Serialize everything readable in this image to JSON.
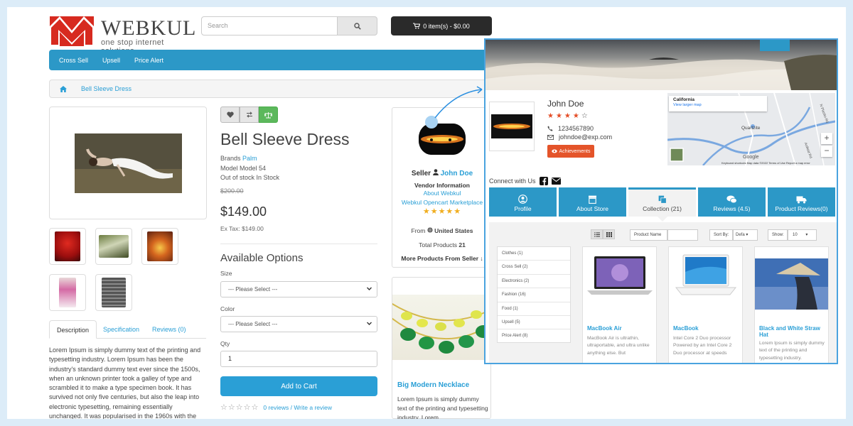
{
  "header": {
    "logo_name": "WEBKUL",
    "logo_tagline": "one stop internet solutions",
    "search_placeholder": "Search",
    "cart_label": "0 item(s) - $0.00"
  },
  "nav": {
    "items": [
      "Cross Sell",
      "Upsell",
      "Price Alert"
    ]
  },
  "breadcrumb": {
    "current": "Bell Sleeve Dress"
  },
  "product": {
    "title": "Bell Sleeve Dress",
    "brand_label": "Brands",
    "brand": "Palm",
    "model": "Model Model 54",
    "stock": "Out of stock In Stock",
    "old_price": "$200.00",
    "price": "$149.00",
    "ex_tax": "Ex Tax: $149.00",
    "options_title": "Available Options",
    "size_label": "Size",
    "size_value": "--- Please Select ---",
    "color_label": "Color",
    "color_value": "--- Please Select ---",
    "qty_label": "Qty",
    "qty_value": "1",
    "add_to_cart": "Add to Cart",
    "reviews_link": "0 reviews",
    "write_review": "Write a review",
    "tabs": [
      "Description",
      "Specification",
      "Reviews (0)"
    ],
    "description": "Lorem Ipsum is simply dummy text of the printing and typesetting industry. Lorem Ipsum has been the industry's standard dummy text ever since the 1500s, when an unknown printer took a galley of type and scrambled it to make a type specimen book. It has survived not only five centuries, but also the leap into electronic typesetting, remaining essentially unchanged. It was popularised in the 1960s with the release of Letraset sheets containing Lorem"
  },
  "seller": {
    "label": "Seller",
    "name": "John Doe",
    "vendor_info": "Vendor Information",
    "about": "About Webkul",
    "store": "Webkul Opencart Marketplace",
    "rating": 5,
    "from_label": "From",
    "country": "United States",
    "total_label": "Total Products",
    "total": "21",
    "more": "More Products From Seller"
  },
  "related": {
    "title": "Big Modern Necklace",
    "desc": "Lorem Ipsum is simply dummy text of the printing and typesetting industry. Lorem"
  },
  "profile": {
    "name": "John Doe",
    "rating": 4,
    "phone": "1234567890",
    "email": "johndoe@exp.com",
    "achievements": "Achievements",
    "map_title": "California",
    "map_link": "View larger map",
    "map_town": "Quartzite",
    "map_road_a": "N Plasito Rd",
    "map_road_b": "Anfield Rd",
    "map_brand": "Google",
    "map_footer": "Keyboard shortcuts   Map data ©2022   Terms of Use   Report a map error",
    "connect": "Connect with Us",
    "tabs": [
      "Profile",
      "About Store",
      "Collection (21)",
      "Reviews (4.5)",
      "Product Reviews(0)"
    ],
    "filter_product_label": "Product Name",
    "sort_label": "Sort By:",
    "sort_value": "Defa",
    "show_label": "Show:",
    "show_value": "10",
    "categories": [
      "Clothes (1)",
      "Cross Sell (2)",
      "Electronics (2)",
      "Fashion (16)",
      "Food (1)",
      "Upsell (5)",
      "Price Alert (8)"
    ],
    "products": [
      {
        "name": "MacBook Air",
        "desc": "MacBook Air is ultrathin, ultraportable, and ultra unlike anything else. But"
      },
      {
        "name": "MacBook",
        "desc": "Intel Core 2 Duo processor Powered by an Intel Core 2 Duo processor at speeds"
      },
      {
        "name": "Black and White Straw Hat",
        "desc": "Lorem Ipsum is simply dummy text of the printing and typesetting industry."
      }
    ]
  },
  "colors": {
    "accent": "#2c98c7",
    "link": "#2a9fd6",
    "star": "#f0ad1e",
    "achieve": "#e4542a"
  }
}
